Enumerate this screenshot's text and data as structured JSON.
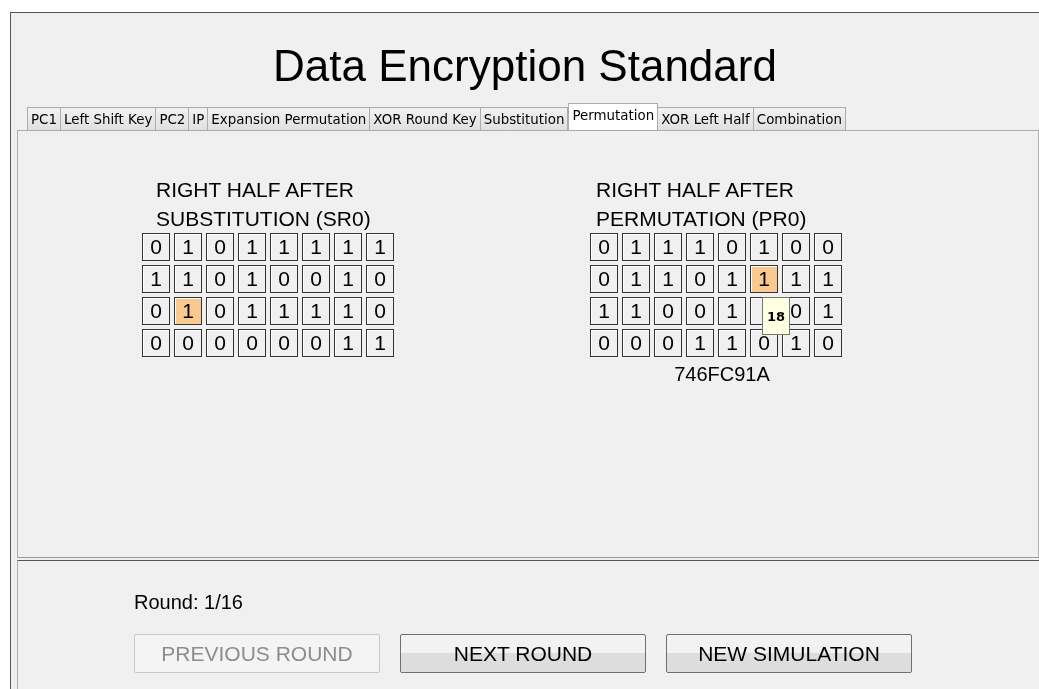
{
  "window": {
    "title": "Data Encryption Standard"
  },
  "tabs": [
    {
      "label": "PC1",
      "selected": false
    },
    {
      "label": "Left Shift Key",
      "selected": false
    },
    {
      "label": "PC2",
      "selected": false
    },
    {
      "label": "IP",
      "selected": false
    },
    {
      "label": "Expansion Permutation",
      "selected": false
    },
    {
      "label": "XOR Round Key",
      "selected": false
    },
    {
      "label": "Substitution",
      "selected": false
    },
    {
      "label": "Permutation",
      "selected": true
    },
    {
      "label": "XOR Left Half",
      "selected": false
    },
    {
      "label": "Combination",
      "selected": false
    }
  ],
  "grids": [
    {
      "title_lines": [
        "RIGHT HALF AFTER",
        "SUBSTITUTION (SR0)"
      ],
      "rows": [
        [
          {
            "bit": "0",
            "highlighted": false
          },
          {
            "bit": "1",
            "highlighted": false
          },
          {
            "bit": "0",
            "highlighted": false
          },
          {
            "bit": "1",
            "highlighted": false
          },
          {
            "bit": "1",
            "highlighted": false
          },
          {
            "bit": "1",
            "highlighted": false
          },
          {
            "bit": "1",
            "highlighted": false
          },
          {
            "bit": "1",
            "highlighted": false
          }
        ],
        [
          {
            "bit": "1",
            "highlighted": false
          },
          {
            "bit": "1",
            "highlighted": false
          },
          {
            "bit": "0",
            "highlighted": false
          },
          {
            "bit": "1",
            "highlighted": false
          },
          {
            "bit": "0",
            "highlighted": false
          },
          {
            "bit": "0",
            "highlighted": false
          },
          {
            "bit": "1",
            "highlighted": false
          },
          {
            "bit": "0",
            "highlighted": false
          }
        ],
        [
          {
            "bit": "0",
            "highlighted": false
          },
          {
            "bit": "1",
            "highlighted": true
          },
          {
            "bit": "0",
            "highlighted": false
          },
          {
            "bit": "1",
            "highlighted": false
          },
          {
            "bit": "1",
            "highlighted": false
          },
          {
            "bit": "1",
            "highlighted": false
          },
          {
            "bit": "1",
            "highlighted": false
          },
          {
            "bit": "0",
            "highlighted": false
          }
        ],
        [
          {
            "bit": "0",
            "highlighted": false
          },
          {
            "bit": "0",
            "highlighted": false
          },
          {
            "bit": "0",
            "highlighted": false
          },
          {
            "bit": "0",
            "highlighted": false
          },
          {
            "bit": "0",
            "highlighted": false
          },
          {
            "bit": "0",
            "highlighted": false
          },
          {
            "bit": "1",
            "highlighted": false
          },
          {
            "bit": "1",
            "highlighted": false
          }
        ]
      ]
    },
    {
      "title_lines": [
        "RIGHT HALF AFTER",
        "PERMUTATION (PR0)"
      ],
      "rows": [
        [
          {
            "bit": "0",
            "highlighted": false
          },
          {
            "bit": "1",
            "highlighted": false
          },
          {
            "bit": "1",
            "highlighted": false
          },
          {
            "bit": "1",
            "highlighted": false
          },
          {
            "bit": "0",
            "highlighted": false
          },
          {
            "bit": "1",
            "highlighted": false
          },
          {
            "bit": "0",
            "highlighted": false
          },
          {
            "bit": "0",
            "highlighted": false
          }
        ],
        [
          {
            "bit": "0",
            "highlighted": false
          },
          {
            "bit": "1",
            "highlighted": false
          },
          {
            "bit": "1",
            "highlighted": false
          },
          {
            "bit": "0",
            "highlighted": false
          },
          {
            "bit": "1",
            "highlighted": false
          },
          {
            "bit": "1",
            "highlighted": true
          },
          {
            "bit": "1",
            "highlighted": false
          },
          {
            "bit": "1",
            "highlighted": false
          }
        ],
        [
          {
            "bit": "1",
            "highlighted": false
          },
          {
            "bit": "1",
            "highlighted": false
          },
          {
            "bit": "0",
            "highlighted": false
          },
          {
            "bit": "0",
            "highlighted": false
          },
          {
            "bit": "1",
            "highlighted": false
          },
          {
            "highlighted": false
          },
          {
            "bit": "0",
            "highlighted": false
          },
          {
            "bit": "1",
            "highlighted": false
          }
        ],
        [
          {
            "bit": "0",
            "highlighted": false
          },
          {
            "bit": "0",
            "highlighted": false
          },
          {
            "bit": "0",
            "highlighted": false
          },
          {
            "bit": "1",
            "highlighted": false
          },
          {
            "bit": "1",
            "highlighted": false
          },
          {
            "bit": "0",
            "highlighted": false
          },
          {
            "bit": "1",
            "highlighted": false
          },
          {
            "bit": "0",
            "highlighted": false
          }
        ]
      ],
      "hex": "746FC91A",
      "tooltip": "18"
    }
  ],
  "round": {
    "label": "Round: 1/16"
  },
  "buttons": [
    {
      "label": "PREVIOUS ROUND",
      "disabled": true
    },
    {
      "label": "NEXT ROUND",
      "disabled": false
    },
    {
      "label": "NEW SIMULATION",
      "disabled": false
    }
  ]
}
